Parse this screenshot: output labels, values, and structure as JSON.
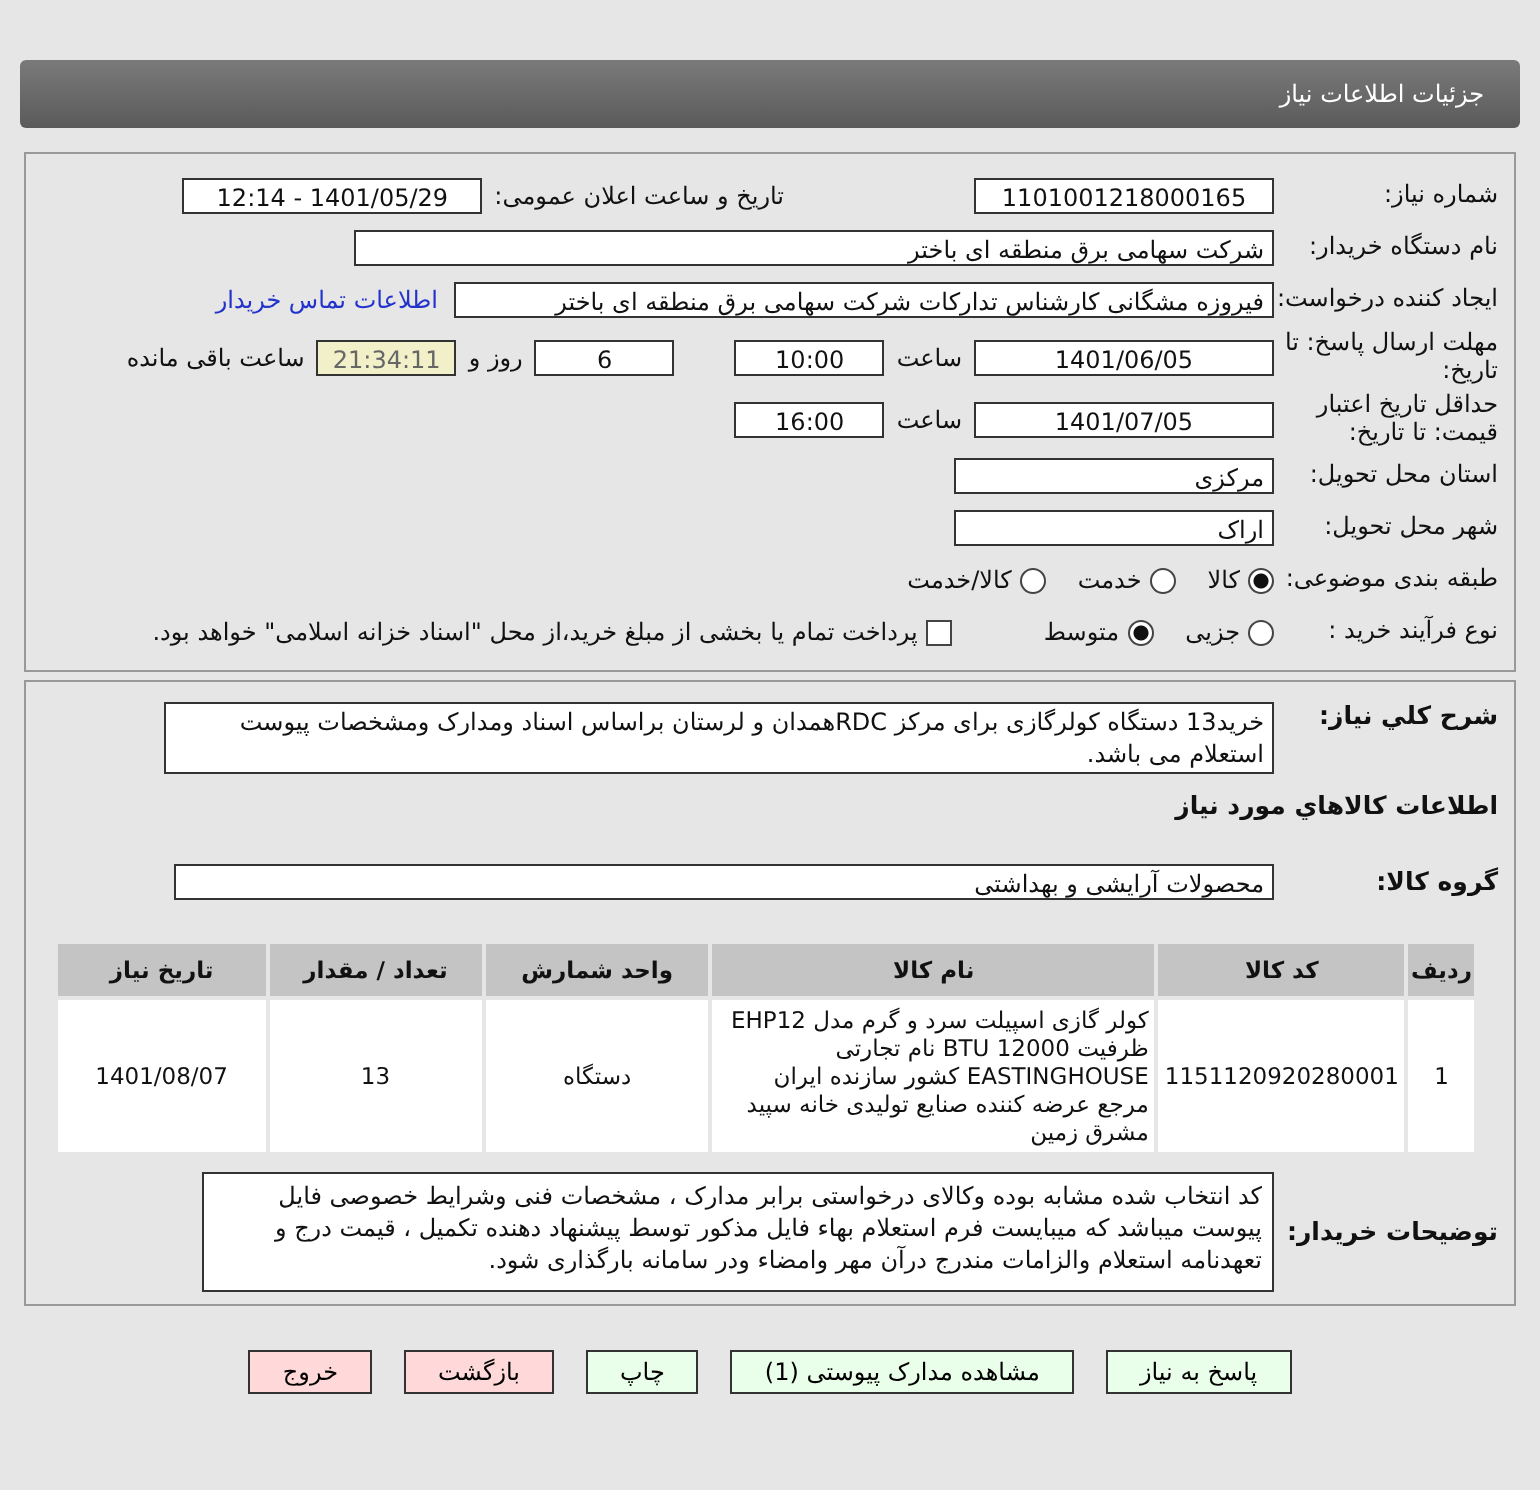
{
  "header": {
    "title": "جزئیات اطلاعات نیاز"
  },
  "need_number": {
    "label": "شماره نیاز:",
    "value": "1101001218000165"
  },
  "announce": {
    "label": "تاریخ و ساعت اعلان عمومی:",
    "value": "1401/05/29 - 12:14"
  },
  "buyer_org": {
    "label": "نام دستگاه خریدار:",
    "value": "شرکت سهامی برق منطقه ای باختر"
  },
  "requester": {
    "label": "ایجاد کننده درخواست:",
    "value": "فیروزه مشگانی کارشناس تدارکات شرکت سهامی برق منطقه ای باختر",
    "link": "اطلاعات تماس خریدار"
  },
  "deadline": {
    "label": "مهلت ارسال پاسخ: تا تاریخ:",
    "date": "1401/06/05",
    "time_label": "ساعت",
    "time": "10:00",
    "days": "6",
    "days_label": "روز و",
    "remaining": "21:34:11",
    "remaining_label": "ساعت باقی مانده"
  },
  "validity": {
    "label": "حداقل تاریخ اعتبار قیمت: تا تاریخ:",
    "date": "1401/07/05",
    "time_label": "ساعت",
    "time": "16:00"
  },
  "province": {
    "label": "استان محل تحویل:",
    "value": "مرکزی"
  },
  "city": {
    "label": "شهر محل تحویل:",
    "value": "اراک"
  },
  "category": {
    "label": "طبقه بندی موضوعی:",
    "options": [
      {
        "label": "کالا",
        "selected": true
      },
      {
        "label": "خدمت",
        "selected": false
      },
      {
        "label": "کالا/خدمت",
        "selected": false
      }
    ]
  },
  "process": {
    "label": "نوع فرآیند خرید :",
    "options": [
      {
        "label": "جزیی",
        "selected": false
      },
      {
        "label": "متوسط",
        "selected": true
      }
    ],
    "payment": {
      "checked": false,
      "label": "پرداخت تمام یا بخشی از مبلغ خرید،از محل \"اسناد خزانه اسلامی\" خواهد بود."
    }
  },
  "description": {
    "label": "شرح کلي نياز:",
    "value": "خرید13 دستگاه کولرگازی برای مرکز RDCهمدان و لرستان براساس اسناد ومدارک ومشخصات پیوست استعلام می باشد."
  },
  "goods_title": "اطلاعات کالاهاي مورد نياز",
  "group": {
    "label": "گروه کالا:",
    "value": "محصولات آرایشی و بهداشتی"
  },
  "table": {
    "columns": [
      "ردیف",
      "کد کالا",
      "نام کالا",
      "واحد شمارش",
      "تعداد / مقدار",
      "تاریخ نیاز"
    ],
    "rows": [
      [
        "1",
        "1151120920280001",
        "کولر گازی اسپیلت سرد و گرم مدل EHP12 ظرفیت BTU 12000 نام تجارتی EASTINGHOUSE کشور سازنده ایران مرجع عرضه کننده صنایع تولیدی خانه سپید مشرق زمین",
        "دستگاه",
        "13",
        "1401/08/07"
      ]
    ]
  },
  "notes": {
    "label": "توضیحات خریدار:",
    "value": "کد انتخاب شده مشابه بوده وکالای درخواستی برابر مدارک ، مشخصات فنی وشرایط خصوصی فایل پیوست میباشد که میبایست فرم استعلام بهاء فایل مذکور توسط پیشنهاد دهنده تکمیل ، قیمت درج و تعهدنامه استعلام والزامات  مندرج درآن مهر وامضاء ودر سامانه بارگذاری شود."
  },
  "buttons": [
    {
      "label": "پاسخ به نیاز",
      "kind": "primary"
    },
    {
      "label": "مشاهده مدارک پیوستی (1)",
      "kind": "primary"
    },
    {
      "label": "چاپ",
      "kind": "primary"
    },
    {
      "label": "بازگشت",
      "kind": "danger"
    },
    {
      "label": "خروج",
      "kind": "danger"
    }
  ]
}
